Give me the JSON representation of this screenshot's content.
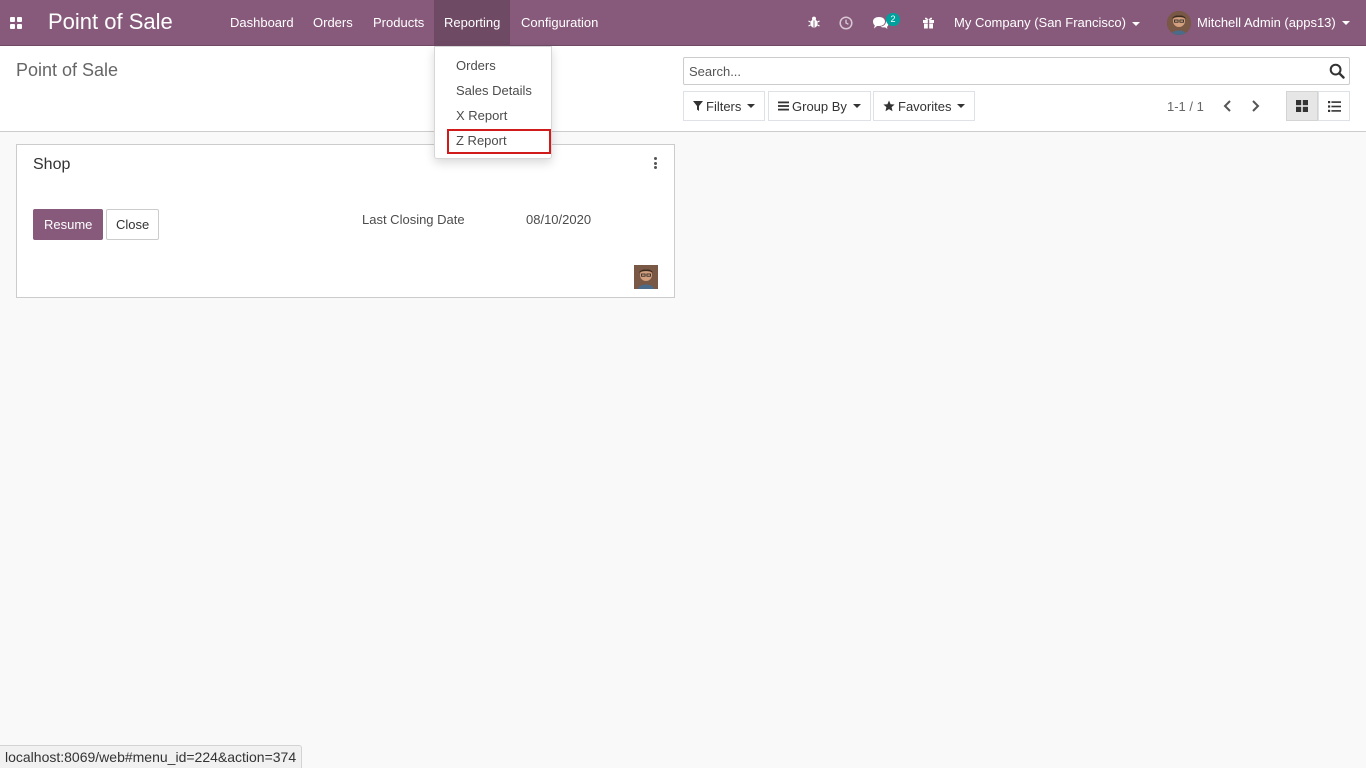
{
  "navbar": {
    "brand": "Point of Sale",
    "menu": [
      {
        "label": "Dashboard"
      },
      {
        "label": "Orders"
      },
      {
        "label": "Products"
      },
      {
        "label": "Reporting"
      },
      {
        "label": "Configuration"
      }
    ],
    "chat_badge": "2",
    "company": "My Company (San Francisco)",
    "user": "Mitchell Admin (apps13)"
  },
  "control_panel": {
    "breadcrumb": "Point of Sale",
    "search_placeholder": "Search...",
    "filters_label": "Filters",
    "groupby_label": "Group By",
    "favorites_label": "Favorites",
    "pager": "1-1 / 1"
  },
  "reporting_menu": {
    "items": [
      {
        "label": "Orders"
      },
      {
        "label": "Sales Details"
      },
      {
        "label": "X Report"
      },
      {
        "label": "Z Report"
      }
    ],
    "highlight_color": "#d11a1a"
  },
  "card": {
    "title": "Shop",
    "resume_label": "Resume",
    "close_label": "Close",
    "closing_label": "Last Closing Date",
    "closing_value": "08/10/2020"
  },
  "statusbar": {
    "url": "localhost:8069/web#menu_id=224&action=374"
  },
  "colors": {
    "brand": "#875a7b",
    "brand_dark": "#6f4a65",
    "badge": "#00a09d"
  }
}
